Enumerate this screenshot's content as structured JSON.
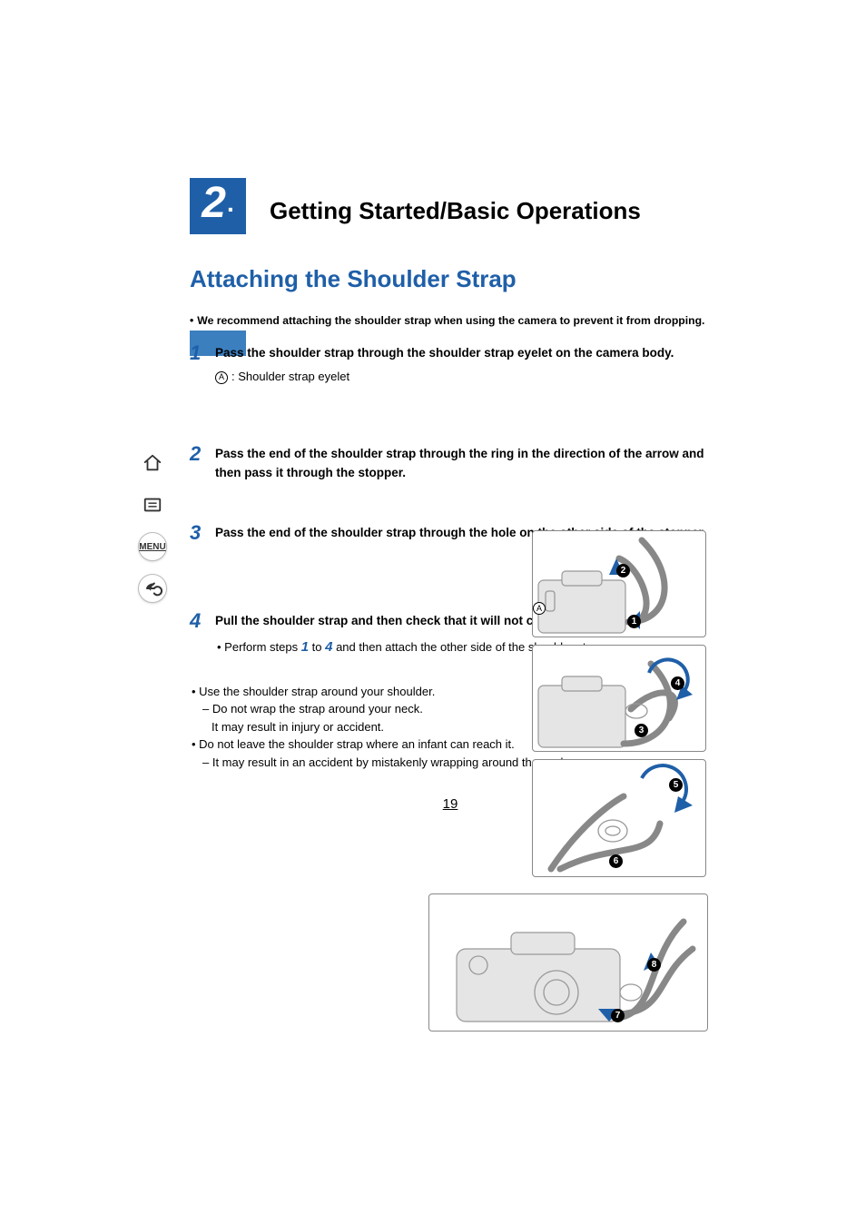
{
  "chapter": {
    "number": "2",
    "dot": ".",
    "title": "Getting Started/Basic Operations"
  },
  "section": {
    "title": "Attaching the Shoulder Strap"
  },
  "intro": "We recommend attaching the shoulder strap when using the camera to prevent it from dropping.",
  "steps": [
    {
      "num": "1",
      "heading": "Pass the shoulder strap through the shoulder strap eyelet on the camera body.",
      "subLabelLetter": "A",
      "subLabelText": ": Shoulder strap eyelet"
    },
    {
      "num": "2",
      "heading": "Pass the end of the shoulder strap through the ring in the direction of the arrow and then pass it through the stopper."
    },
    {
      "num": "3",
      "heading": "Pass the end of the shoulder strap through the hole on the other side of the stopper."
    },
    {
      "num": "4",
      "heading": "Pull the shoulder strap and then check that it will not come out.",
      "notePrefix": "• Perform steps ",
      "noteRef1": "1",
      "noteMid": " to ",
      "noteRef2": "4",
      "noteSuffix": " and then attach the other side of the shoulder strap."
    }
  ],
  "notes": {
    "line1": "• Use the shoulder strap around your shoulder.",
    "line1a": "– Do not wrap the strap around your neck.",
    "line1b": "It may result in injury or accident.",
    "line2": "• Do not leave the shoulder strap where an infant can reach it.",
    "line2a": "– It may result in an accident by mistakenly wrapping around the neck."
  },
  "pageNumber": "19",
  "sidebar": {
    "menuLabel": "MENU"
  },
  "callouts": {
    "fig1": {
      "letter": "A",
      "n1": "1",
      "n2": "2"
    },
    "fig2": {
      "n3": "3",
      "n4": "4"
    },
    "fig3": {
      "n5": "5",
      "n6": "6"
    },
    "fig4": {
      "n7": "7",
      "n8": "8"
    }
  }
}
